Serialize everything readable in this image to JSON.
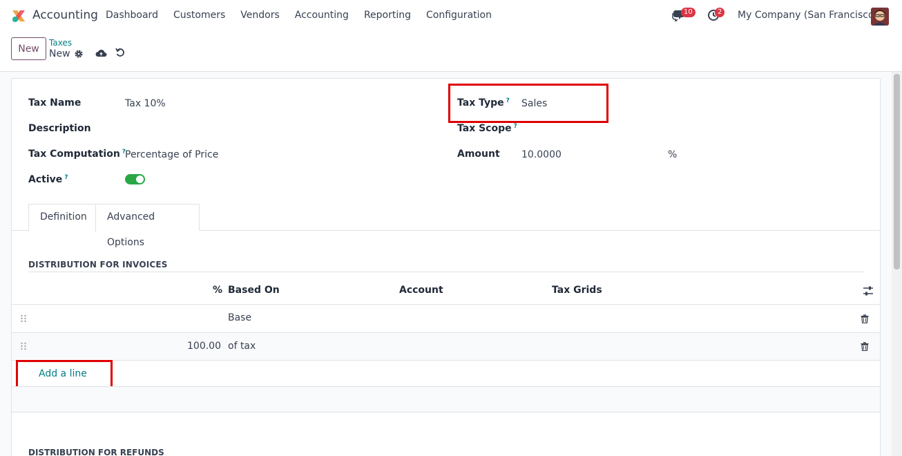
{
  "navbar": {
    "app_name": "Accounting",
    "menu": [
      "Dashboard",
      "Customers",
      "Vendors",
      "Accounting",
      "Reporting",
      "Configuration"
    ],
    "chat_count": "10",
    "activity_count": "2",
    "company": "My Company (San Francisco)"
  },
  "control": {
    "new_label": "New",
    "breadcrumb_parent": "Taxes",
    "breadcrumb_current": "New"
  },
  "form": {
    "tax_name_label": "Tax Name",
    "tax_name_value": "Tax 10%",
    "description_label": "Description",
    "tax_computation_label": "Tax Computation",
    "tax_computation_value": "Percentage of Price",
    "active_label": "Active",
    "tax_type_label": "Tax Type",
    "tax_type_value": "Sales",
    "tax_scope_label": "Tax Scope",
    "amount_label": "Amount",
    "amount_value": "10.0000",
    "amount_unit": "%",
    "help_mark": "?"
  },
  "tabs": [
    "Definition",
    "Advanced Options"
  ],
  "distribution": {
    "invoices_title": "DISTRIBUTION FOR INVOICES",
    "refunds_title": "DISTRIBUTION FOR REFUNDS",
    "columns": [
      "%",
      "Based On",
      "Account",
      "Tax Grids"
    ],
    "rows": [
      {
        "percent": "",
        "based_on": "Base"
      },
      {
        "percent": "100.00",
        "based_on": "of tax"
      }
    ],
    "add_line": "Add a line"
  },
  "colors": {
    "accent": "#714b67",
    "link": "#017e84",
    "highlight": "#e00000",
    "toggle_on": "#28a745"
  }
}
